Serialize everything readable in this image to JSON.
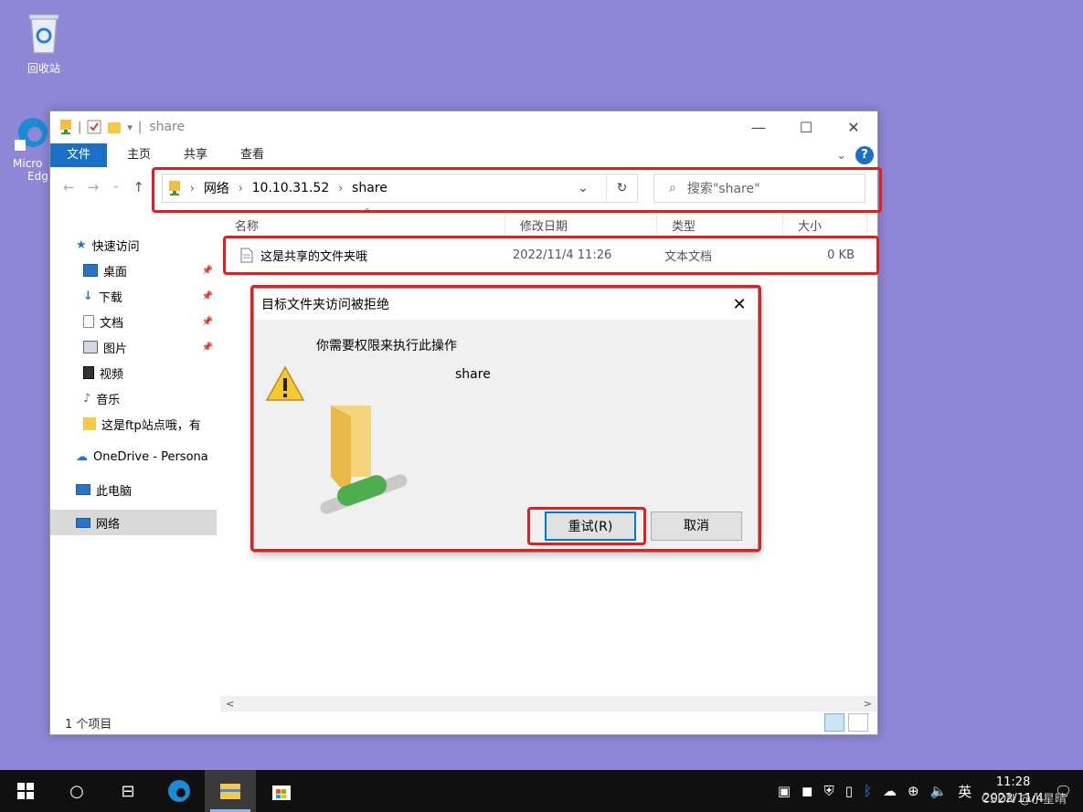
{
  "desktop": {
    "recycle_bin_label": "回收站",
    "edge_label_1": "Micro",
    "edge_label_2": "Edg"
  },
  "explorer": {
    "title": "share",
    "tabs": {
      "file": "文件",
      "home": "主页",
      "share": "共享",
      "view": "查看"
    },
    "address": {
      "root": "网络",
      "host": "10.10.31.52",
      "folder": "share"
    },
    "search_placeholder": "搜索\"share\"",
    "sidebar": {
      "quick_access": "快速访问",
      "items": [
        "桌面",
        "下载",
        "文档",
        "图片",
        "视频",
        "音乐",
        "这是ftp站点哦，有"
      ],
      "onedrive": "OneDrive - Persona",
      "this_pc": "此电脑",
      "network": "网络"
    },
    "columns": {
      "name": "名称",
      "modified": "修改日期",
      "type": "类型",
      "size": "大小"
    },
    "files": [
      {
        "name": "这是共享的文件夹哦",
        "modified": "2022/11/4 11:26",
        "type": "文本文档",
        "size": "0 KB"
      }
    ],
    "status_text": "1 个项目"
  },
  "dialog": {
    "title": "目标文件夹访问被拒绝",
    "message": "你需要权限来执行此操作",
    "item_name": "share",
    "retry_label": "重试(R)",
    "cancel_label": "取消"
  },
  "taskbar": {
    "tray_lang": "英",
    "time": "11:28",
    "date": "2022/11/4",
    "watermark": "CSDN @小星晴"
  },
  "colors": {
    "desktop": "#8e86d6",
    "accent": "#1a6fc7",
    "highlight": "#e02020"
  }
}
